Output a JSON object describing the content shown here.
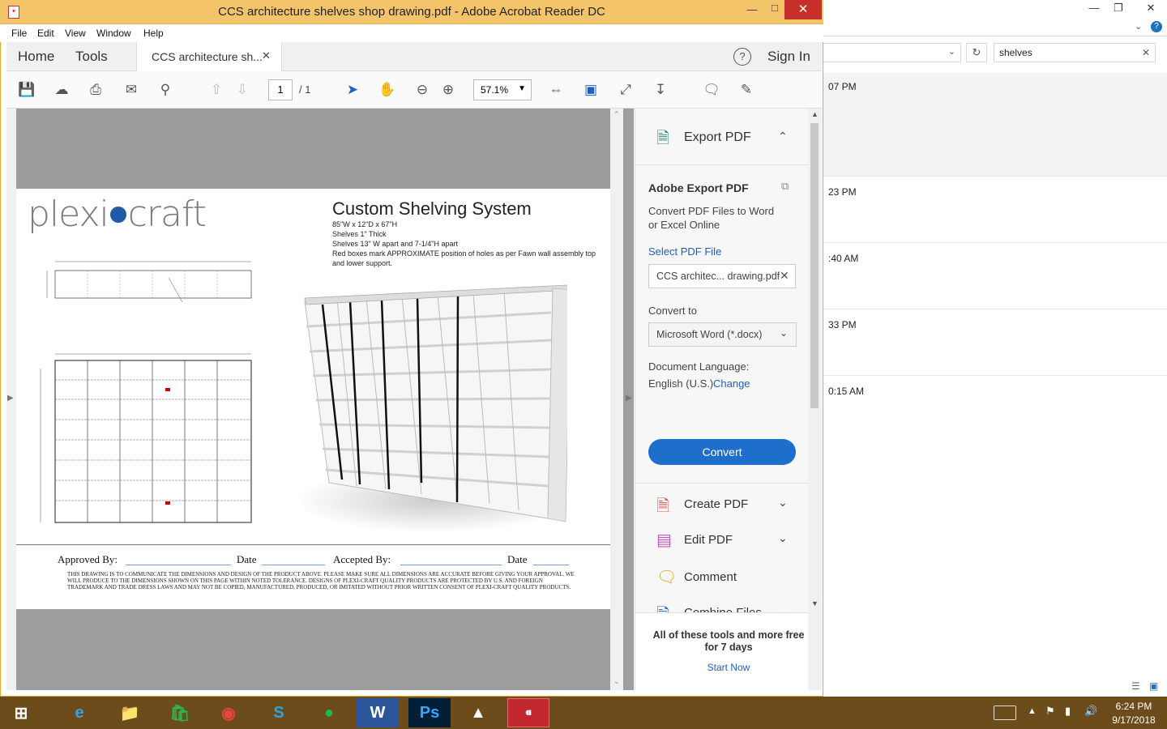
{
  "window": {
    "title": "CCS architecture shelves shop drawing.pdf - Adobe Acrobat Reader DC"
  },
  "menu": [
    "File",
    "Edit",
    "View",
    "Window",
    "Help"
  ],
  "tabs": {
    "home": "Home",
    "tools": "Tools",
    "doc": "CCS architecture sh...",
    "signin": "Sign In"
  },
  "toolbar": {
    "page_current": "1",
    "page_total": "/ 1",
    "zoom": "57.1%"
  },
  "drawing": {
    "logo_left": "plexi",
    "logo_right": "craft",
    "title": "Custom Shelving System",
    "spec1": "85\"W x 12\"D x 67\"H",
    "spec2": "Shelves 1\" Thick",
    "spec3": "Shelves 13\" W apart and 7-1/4\"H apart",
    "spec4": "Red boxes mark APPROXIMATE position of holes as per Fawn wall assembly top and lower support.",
    "approved": "Approved By:",
    "date1": "Date",
    "accepted": "Accepted By:",
    "date2": "Date",
    "disclaimer": "THIS DRAWING IS TO COMMUNICATE THE DIMENSIONS AND DESIGN OF THE PRODUCT ABOVE.  PLEASE MAKE SURE ALL DIMENSIONS ARE ACCURATE BEFORE GIVING YOUR APPROVAL.  WE WILL PRODUCE TO THE DIMENSIONS SHOWN ON THIS PAGE WITHIN NOTED TOLERANCE.  DESIGNS OF PLEXI-CRAFT QUALITY PRODUCTS ARE PROTECTED BY U.S. AND FOREIGN TRADEMARK AND TRADE DRESS LAWS AND MAY NOT BE COPIED, MANUFACTURED, PRODUCED, OR  IMITATED WITHOUT PRIOR WRITTEN CONSENT OF PLEXI-CRAFT QUALITY PRODUCTS."
  },
  "panel": {
    "export_header": "Export PDF",
    "adobe_export": "Adobe Export PDF",
    "desc": "Convert PDF Files to Word or Excel Online",
    "select_file": "Select PDF File",
    "file_value": "CCS architec... drawing.pdf",
    "convert_to": "Convert to",
    "format": "Microsoft Word (*.docx)",
    "doc_lang": "Document Language:",
    "lang_value": "English (U.S.)",
    "change": "Change",
    "convert_btn": "Convert",
    "create_pdf": "Create PDF",
    "edit_pdf": "Edit PDF",
    "comment": "Comment",
    "combine": "Combine Files",
    "promo": "All of these tools and more free for 7 days",
    "start_now": "Start Now"
  },
  "explorer": {
    "search_value": "shelves",
    "rows": [
      "07 PM",
      "23 PM",
      ":40 AM",
      "33 PM",
      "0:15 AM"
    ]
  },
  "taskbar": {
    "time": "6:24 PM",
    "date": "9/17/2018"
  }
}
